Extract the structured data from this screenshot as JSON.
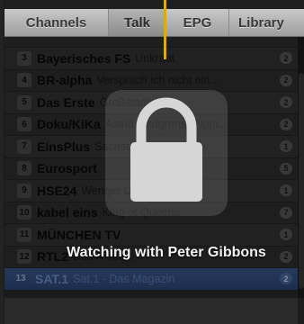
{
  "tabs": [
    {
      "label": "Channels",
      "active": false
    },
    {
      "label": "Talk",
      "active": true
    },
    {
      "label": "EPG",
      "active": false
    },
    {
      "label": "Library",
      "active": false
    }
  ],
  "channels": [
    {
      "number": "",
      "name": "",
      "show": "",
      "count": ""
    },
    {
      "number": "3",
      "name": "Bayerisches FS",
      "show": "Unkraut",
      "count": "2"
    },
    {
      "number": "4",
      "name": "BR-alpha",
      "show": "Versprach ich nicht ein...",
      "count": "2"
    },
    {
      "number": "5",
      "name": "Das Erste",
      "show": "Großstadtrevier",
      "count": "2"
    },
    {
      "number": "6",
      "name": "Doku/KiKa",
      "show": "Astrid Lindgrens: Pippi...",
      "count": "2"
    },
    {
      "number": "7",
      "name": "EinsPlus",
      "show": "Sachsen-Anhalt heute",
      "count": "1"
    },
    {
      "number": "8",
      "name": "Eurosport",
      "show": "",
      "count": "5"
    },
    {
      "number": "9",
      "name": "HSE24",
      "show": "Wenger Uhren",
      "count": "1"
    },
    {
      "number": "10",
      "name": "kabel eins",
      "show": "King of Queens",
      "count": "7"
    },
    {
      "number": "11",
      "name": "MÜNCHEN TV",
      "show": "",
      "count": "1"
    },
    {
      "number": "12",
      "name": "RTL2",
      "show": "Das A-Team",
      "count": "2"
    },
    {
      "number": "13",
      "name": "SAT.1",
      "show": "Sat.1 - Das Magazin",
      "count": "2",
      "selected": true
    }
  ],
  "overlay": {
    "icon": "lock-icon",
    "message": "Watching with Peter Gibbons"
  },
  "colors": {
    "accent": "#e6a320",
    "selection": "#3d5a8e"
  }
}
